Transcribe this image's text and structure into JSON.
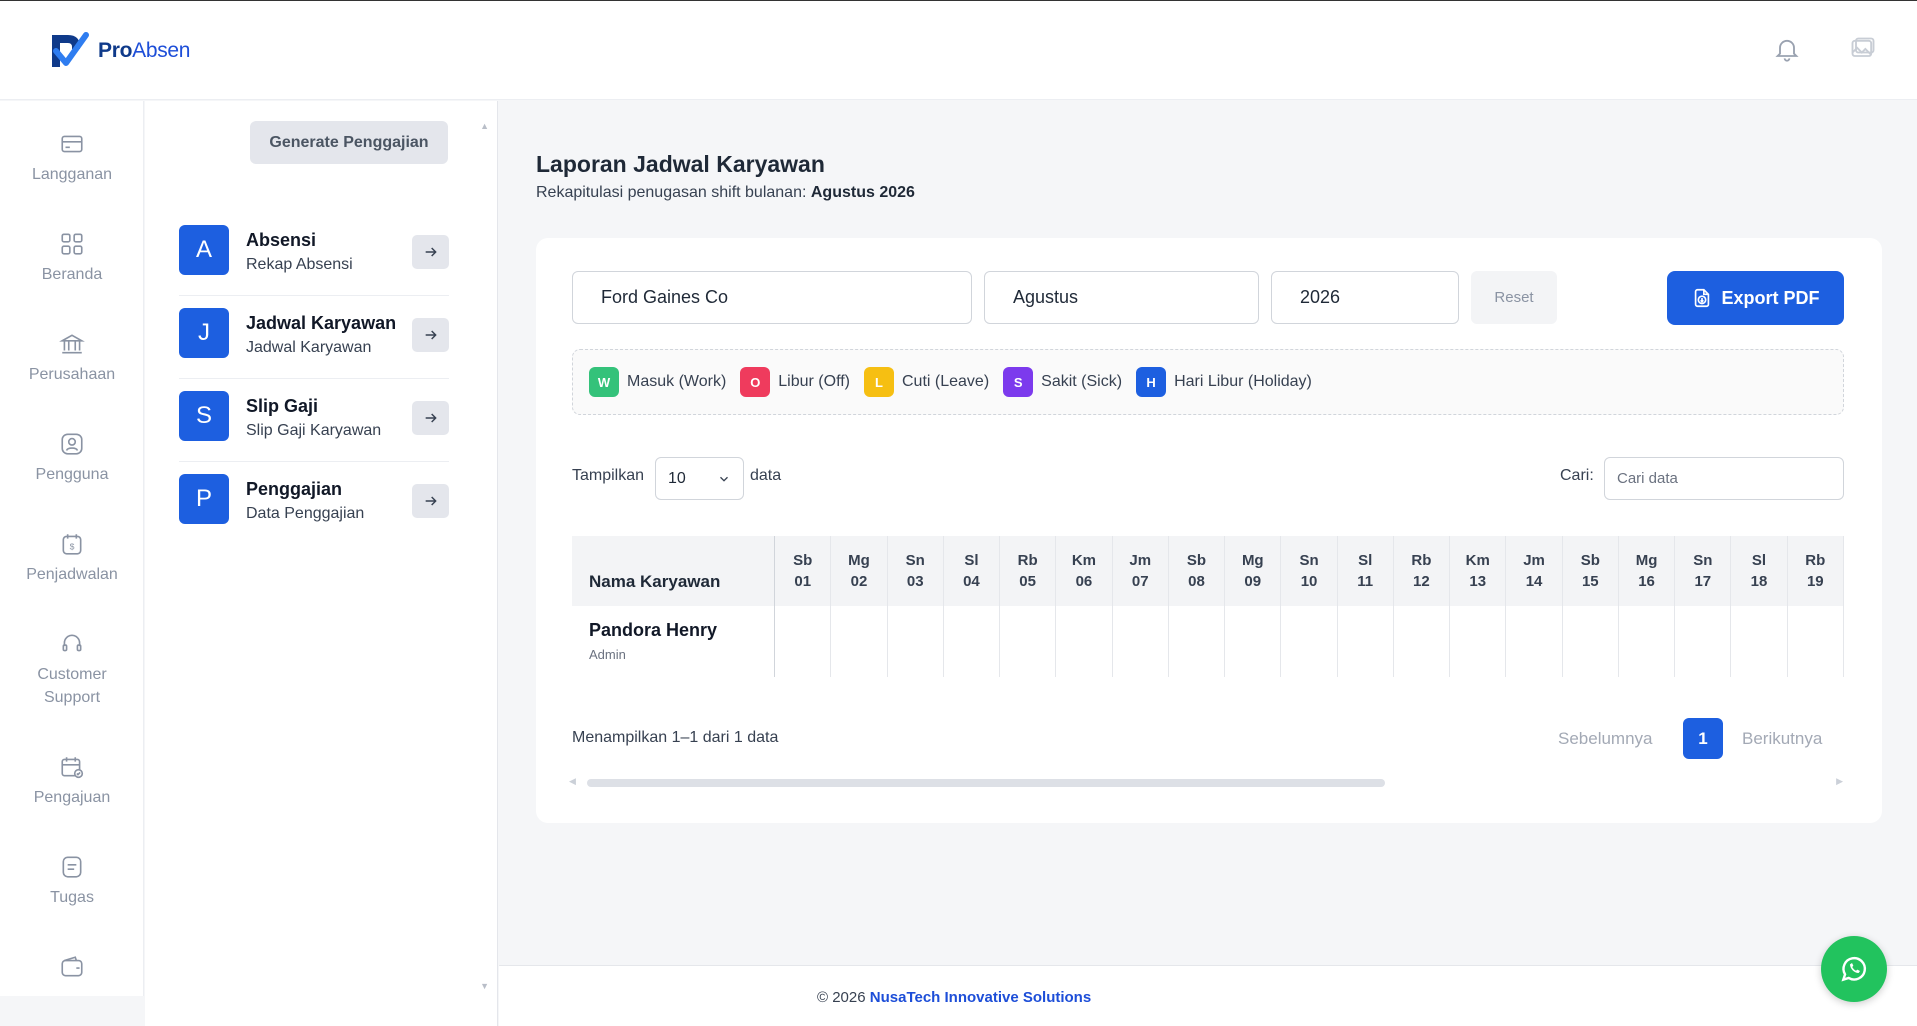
{
  "brand": {
    "name_bold": "Pro",
    "name_rest": "Absen"
  },
  "colors": {
    "primary": "#1d5fe0",
    "work": "#34c27a",
    "off": "#ef3b5d",
    "leave": "#f6bf12",
    "sick": "#7c3aed",
    "holiday": "#1d5fe0"
  },
  "nav": [
    {
      "label": "Langganan",
      "icon": "credit-card-icon"
    },
    {
      "label": "Beranda",
      "icon": "grid-icon"
    },
    {
      "label": "Perusahaan",
      "icon": "bank-icon"
    },
    {
      "label": "Pengguna",
      "icon": "user-circle-icon"
    },
    {
      "label": "Penjadwalan",
      "icon": "schedule-icon"
    },
    {
      "label": "Customer Support",
      "icon": "headset-icon"
    },
    {
      "label": "Pengajuan",
      "icon": "calendar-check-icon"
    },
    {
      "label": "Tugas",
      "icon": "task-icon"
    }
  ],
  "subpanel": {
    "generate_label": "Generate Penggajian",
    "items": [
      {
        "badge": "A",
        "title": "Absensi",
        "desc": "Rekap Absensi"
      },
      {
        "badge": "J",
        "title": "Jadwal Karyawan",
        "desc": "Jadwal Karyawan"
      },
      {
        "badge": "S",
        "title": "Slip Gaji",
        "desc": "Slip Gaji Karyawan"
      },
      {
        "badge": "P",
        "title": "Penggajian",
        "desc": "Data Penggajian"
      }
    ]
  },
  "page": {
    "title": "Laporan Jadwal Karyawan",
    "subtitle_prefix": "Rekapitulasi penugasan shift bulanan:",
    "subtitle_period": "Agustus 2026"
  },
  "filters": {
    "company": "Ford Gaines Co",
    "month": "Agustus",
    "year": "2026",
    "reset_label": "Reset",
    "export_label": "Export PDF"
  },
  "legend": [
    {
      "code": "W",
      "label": "Masuk (Work)",
      "color": "#34c27a"
    },
    {
      "code": "O",
      "label": "Libur (Off)",
      "color": "#ef3b5d"
    },
    {
      "code": "L",
      "label": "Cuti (Leave)",
      "color": "#f6bf12"
    },
    {
      "code": "S",
      "label": "Sakit (Sick)",
      "color": "#7c3aed"
    },
    {
      "code": "H",
      "label": "Hari Libur (Holiday)",
      "color": "#1d5fe0"
    }
  ],
  "table_controls": {
    "show_label": "Tampilkan",
    "page_size": "10",
    "data_label": "data",
    "search_label": "Cari:",
    "search_placeholder": "Cari data"
  },
  "table": {
    "name_header": "Nama Karyawan",
    "days": [
      {
        "d": "Sb",
        "n": "01"
      },
      {
        "d": "Mg",
        "n": "02"
      },
      {
        "d": "Sn",
        "n": "03"
      },
      {
        "d": "Sl",
        "n": "04"
      },
      {
        "d": "Rb",
        "n": "05"
      },
      {
        "d": "Km",
        "n": "06"
      },
      {
        "d": "Jm",
        "n": "07"
      },
      {
        "d": "Sb",
        "n": "08"
      },
      {
        "d": "Mg",
        "n": "09"
      },
      {
        "d": "Sn",
        "n": "10"
      },
      {
        "d": "Sl",
        "n": "11"
      },
      {
        "d": "Rb",
        "n": "12"
      },
      {
        "d": "Km",
        "n": "13"
      },
      {
        "d": "Jm",
        "n": "14"
      },
      {
        "d": "Sb",
        "n": "15"
      },
      {
        "d": "Mg",
        "n": "16"
      },
      {
        "d": "Sn",
        "n": "17"
      },
      {
        "d": "Sl",
        "n": "18"
      },
      {
        "d": "Rb",
        "n": "19"
      }
    ],
    "rows": [
      {
        "name": "Pandora Henry",
        "role": "Admin"
      }
    ]
  },
  "pagination": {
    "info": "Menampilkan 1–1 dari 1 data",
    "prev": "Sebelumnya",
    "current": "1",
    "next": "Berikutnya"
  },
  "footer": {
    "copyright": "© 2026",
    "company": "NusaTech Innovative Solutions"
  }
}
